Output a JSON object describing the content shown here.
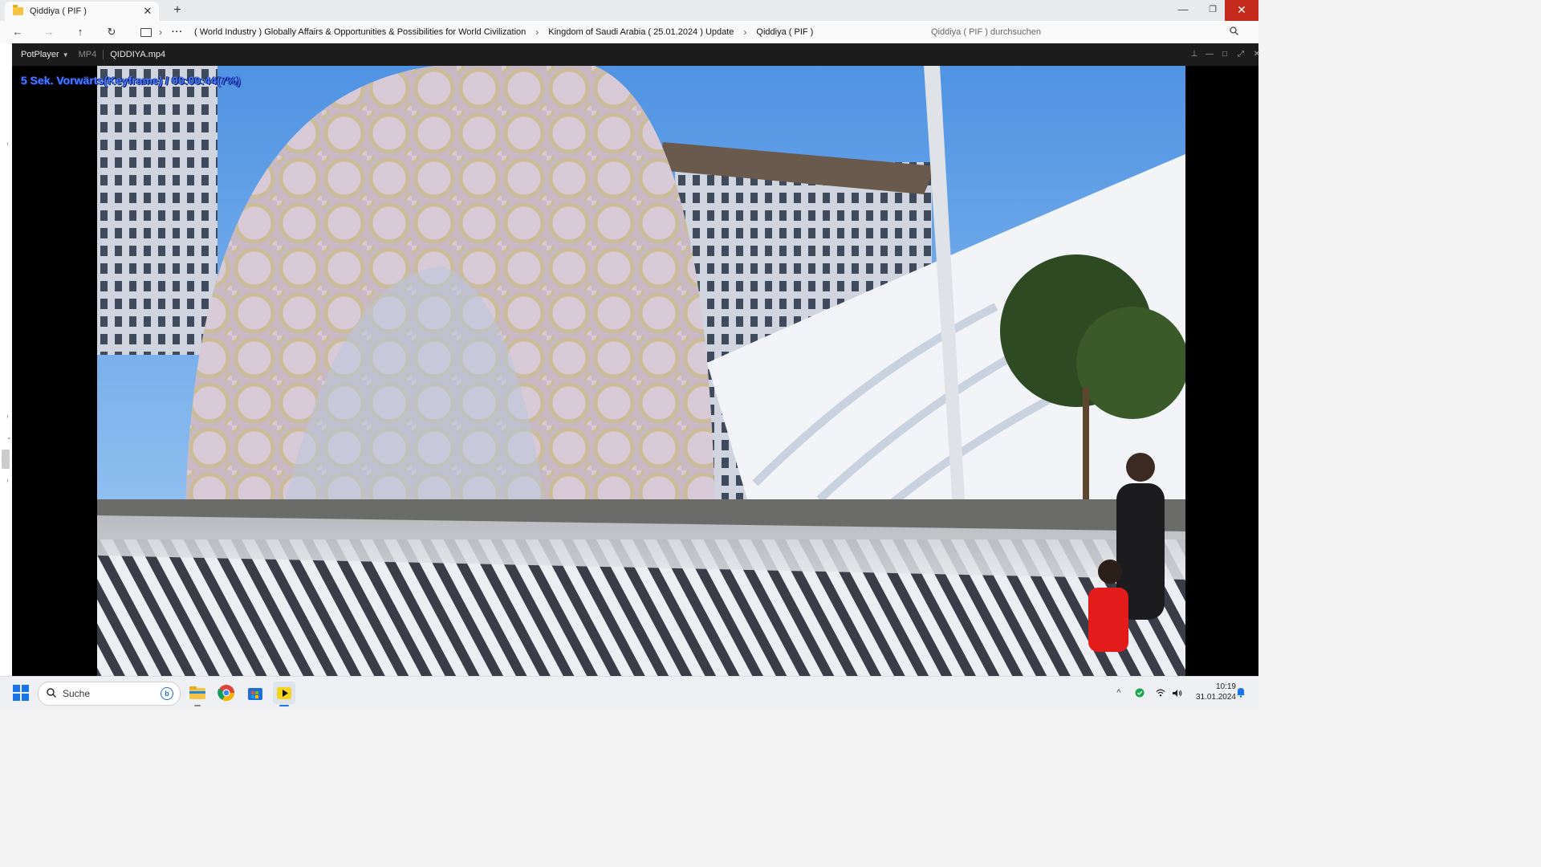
{
  "explorer": {
    "tab_title": "Qiddiya ( PIF )",
    "close_glyph": "✕",
    "new_tab_glyph": "+",
    "window": {
      "minimize": "—",
      "maximize": "❐",
      "close": "✕"
    },
    "nav": {
      "back": "←",
      "forward": "→",
      "up": "↑",
      "refresh": "↻"
    },
    "breadcrumb": {
      "more": "···",
      "separator": "›",
      "items": [
        "( World Industry ) Globally Affairs & Opportunities & Possibilities for World Civilization",
        "Kingdom of Saudi Arabia ( 25.01.2024 ) Update",
        "Qiddiya ( PIF )"
      ]
    },
    "search_placeholder": "Qiddiya ( PIF ) durchsuchen"
  },
  "player": {
    "brand": "PotPlayer",
    "format": "MP4",
    "filename": "QIDDIYA.mp4",
    "osd": "5  Sek. Vorwärts(Keyframe) / 00:00:44(7%)",
    "progress_percent": 7,
    "controls": {
      "pin": "⊥",
      "minimize": "—",
      "maximize": "□",
      "fullscreen": "⤢",
      "close": "✕"
    }
  },
  "taskbar": {
    "search_placeholder": "Suche",
    "apps": [
      "file-explorer",
      "chrome",
      "microsoft-store",
      "potplayer"
    ],
    "tray_chevron": "^",
    "time": "10:19",
    "date": "31.01.2024"
  },
  "colors": {
    "accent": "#1a73e8",
    "close_red": "#c42b1c",
    "osd_blue": "#4d7bff"
  }
}
